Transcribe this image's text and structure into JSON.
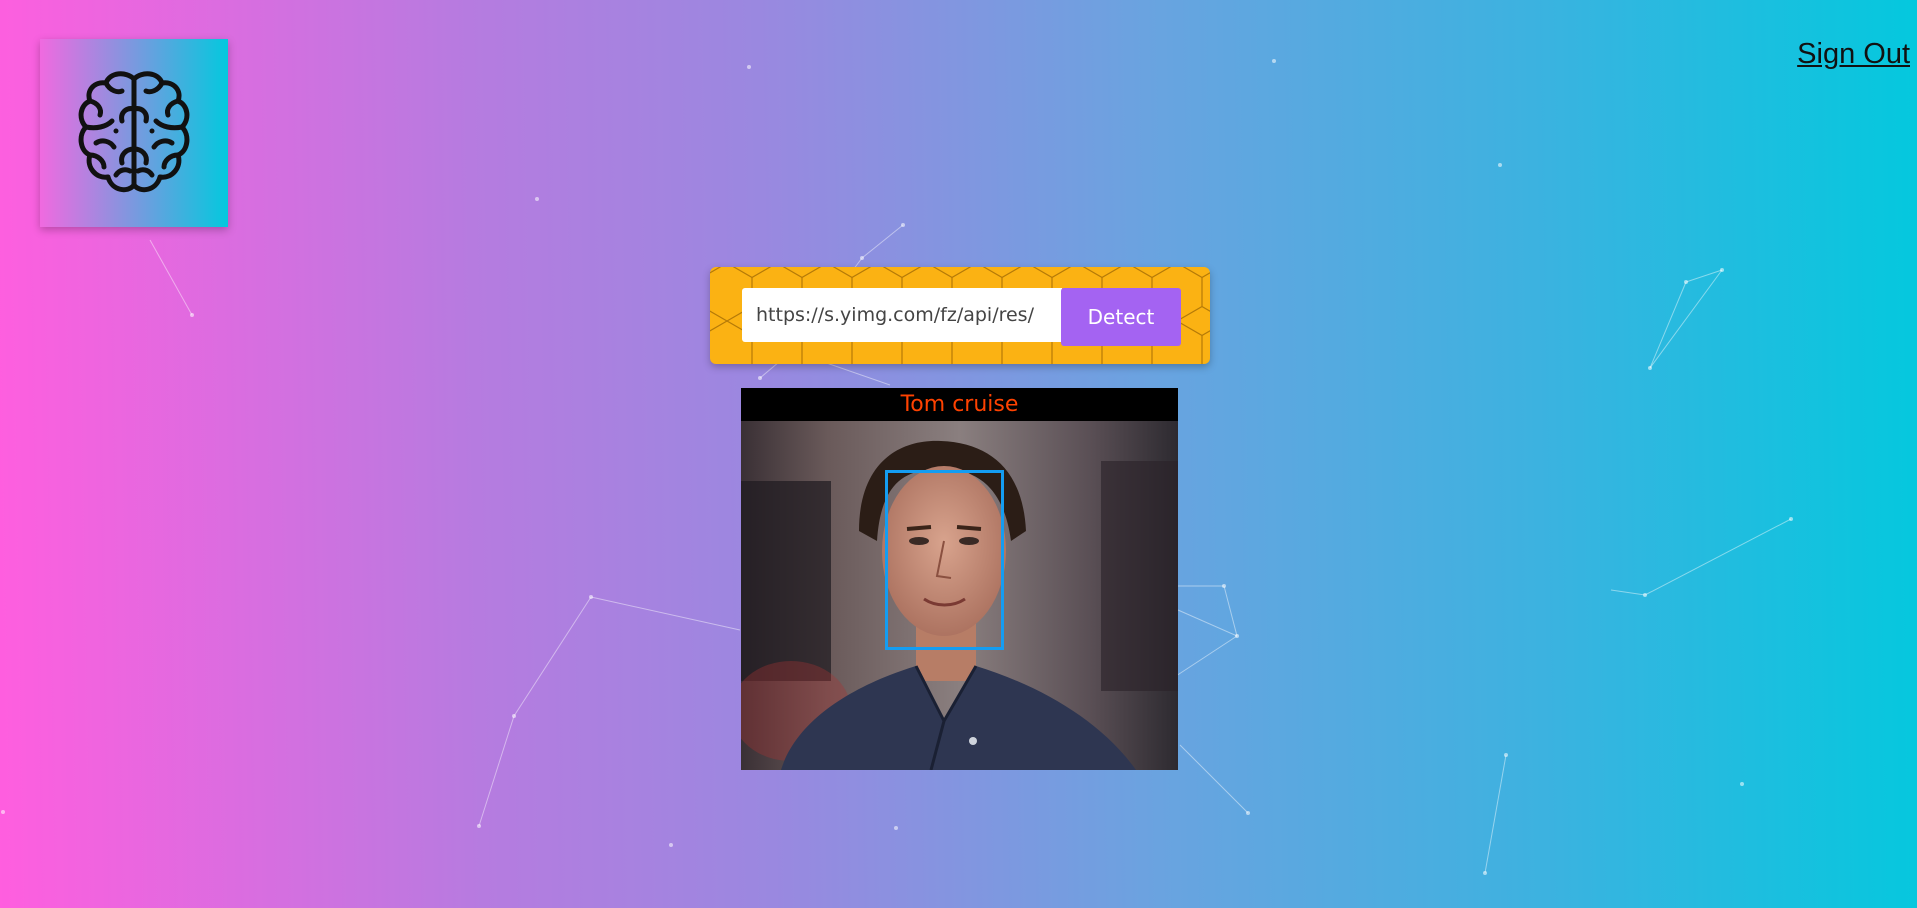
{
  "header": {
    "logo_icon": "brain-icon",
    "signout_label": "Sign Out"
  },
  "form": {
    "url_value": "https://s.yimg.com/fz/api/res/",
    "detect_label": "Detect"
  },
  "result": {
    "name": "Tom cruise",
    "photo_description_icon": "face-photo"
  },
  "colors": {
    "gradient_start": "#ff5edf",
    "gradient_end": "#04c8de",
    "form_bg": "#fbb213",
    "button_bg": "#a463f2",
    "face_box": "#149df2",
    "name_color": "#ff4200"
  }
}
